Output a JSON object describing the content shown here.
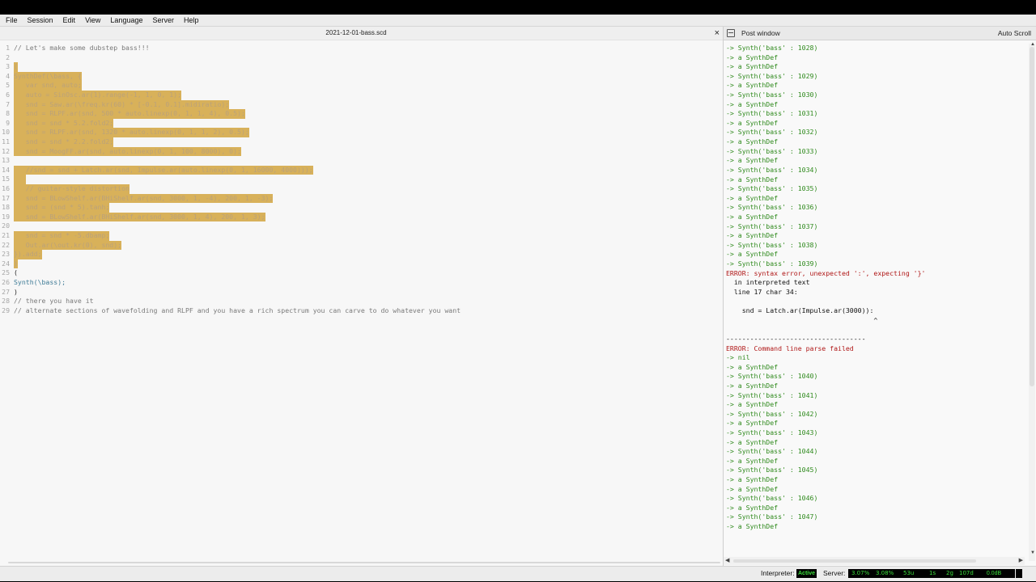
{
  "menu": [
    "File",
    "Session",
    "Edit",
    "View",
    "Language",
    "Server",
    "Help"
  ],
  "editor": {
    "title": "2021-12-01-bass.scd",
    "close": "×",
    "lines": [
      {
        "n": "1",
        "text": "// Let's make some dubstep bass!!!",
        "cls": "comment",
        "sel": false
      },
      {
        "n": "2",
        "text": "",
        "cls": "plain",
        "sel": false
      },
      {
        "n": "3",
        "text": "(",
        "cls": "plain",
        "sel": true
      },
      {
        "n": "4",
        "text": "SynthDef(\\bass, {",
        "cls": "plain",
        "sel": true
      },
      {
        "n": "5",
        "text": "   var snd, auto;",
        "cls": "plain",
        "sel": true
      },
      {
        "n": "6",
        "text": "   auto = SinOsc.ar(1).range(-1, 1, 0, 1);",
        "cls": "plain",
        "sel": true
      },
      {
        "n": "7",
        "text": "   snd = Saw.ar(\\freq.kr(60) * [-0.1, 0.1].midiratio);",
        "cls": "plain",
        "sel": true
      },
      {
        "n": "8",
        "text": "   snd = RLPF.ar(snd, 500 * auto.linexp(0, 1, 1, 4), 0.5);",
        "cls": "plain",
        "sel": true
      },
      {
        "n": "9",
        "text": "   snd = snd * 5.2.fold2;",
        "cls": "plain",
        "sel": true
      },
      {
        "n": "10",
        "text": "   snd = RLPF.ar(snd, 1320 * auto.linexp(0, 1, 1, 2), 0.5);",
        "cls": "plain",
        "sel": true
      },
      {
        "n": "11",
        "text": "   snd = snd * 2.2.fold2;",
        "cls": "plain",
        "sel": true
      },
      {
        "n": "12",
        "text": "   snd = MoogFF.ar(snd, auto.linexp(0, 1, 100, 8000), 0);",
        "cls": "plain",
        "sel": true
      },
      {
        "n": "13",
        "text": "",
        "cls": "plain",
        "sel": true
      },
      {
        "n": "14",
        "text": "   //snd = snd + Latch.ar(snd, Impulse.ar(auto.linexp(0, 1, 16000, 4000)));",
        "cls": "plain",
        "sel": true
      },
      {
        "n": "15",
        "text": "   ",
        "cls": "plain",
        "sel": true
      },
      {
        "n": "16",
        "text": "   // guitar-style distortion",
        "cls": "plain",
        "sel": true
      },
      {
        "n": "17",
        "text": "   snd = BLowShelf.ar(BHiShelf.ar(snd, 3000, 1, -4), 200, 1, -3);",
        "cls": "plain",
        "sel": true
      },
      {
        "n": "18",
        "text": "   snd = (snd * 5).tanh;",
        "cls": "plain",
        "sel": true
      },
      {
        "n": "19",
        "text": "   snd = BLowShelf.ar(BHiShelf.ar(snd, 3000, 1, 4), 200, 1, 3);",
        "cls": "plain",
        "sel": true
      },
      {
        "n": "20",
        "text": "",
        "cls": "plain",
        "sel": false
      },
      {
        "n": "21",
        "text": "   snd = snd * -5.dbamp;",
        "cls": "plain",
        "sel": true
      },
      {
        "n": "22",
        "text": "   Out.ar(\\out.kr(0), snd);",
        "cls": "plain",
        "sel": true
      },
      {
        "n": "23",
        "text": "}).add;",
        "cls": "plain",
        "sel": true
      },
      {
        "n": "24",
        "text": ")",
        "cls": "plain",
        "sel": true
      },
      {
        "n": "25",
        "text": "(",
        "cls": "plain",
        "sel": false
      },
      {
        "n": "26",
        "text": "Synth(\\bass);",
        "cls": "def",
        "sel": false
      },
      {
        "n": "27",
        "text": ")",
        "cls": "plain",
        "sel": false
      },
      {
        "n": "28",
        "text": "// there you have it",
        "cls": "comment",
        "sel": false
      },
      {
        "n": "29",
        "text": "// alternate sections of wavefolding and RLPF and you have a rich spectrum you can carve to do whatever you want",
        "cls": "comment",
        "sel": false
      }
    ]
  },
  "post": {
    "title": "Post window",
    "autoscroll": "Auto Scroll",
    "lines": [
      {
        "t": "-> Synth('bass' : 1028)",
        "c": "green"
      },
      {
        "t": "-> a SynthDef",
        "c": "green"
      },
      {
        "t": "-> a SynthDef",
        "c": "green"
      },
      {
        "t": "-> Synth('bass' : 1029)",
        "c": "green"
      },
      {
        "t": "-> a SynthDef",
        "c": "green"
      },
      {
        "t": "-> Synth('bass' : 1030)",
        "c": "green"
      },
      {
        "t": "-> a SynthDef",
        "c": "green"
      },
      {
        "t": "-> Synth('bass' : 1031)",
        "c": "green"
      },
      {
        "t": "-> a SynthDef",
        "c": "green"
      },
      {
        "t": "-> Synth('bass' : 1032)",
        "c": "green"
      },
      {
        "t": "-> a SynthDef",
        "c": "green"
      },
      {
        "t": "-> Synth('bass' : 1033)",
        "c": "green"
      },
      {
        "t": "-> a SynthDef",
        "c": "green"
      },
      {
        "t": "-> Synth('bass' : 1034)",
        "c": "green"
      },
      {
        "t": "-> a SynthDef",
        "c": "green"
      },
      {
        "t": "-> Synth('bass' : 1035)",
        "c": "green"
      },
      {
        "t": "-> a SynthDef",
        "c": "green"
      },
      {
        "t": "-> Synth('bass' : 1036)",
        "c": "green"
      },
      {
        "t": "-> a SynthDef",
        "c": "green"
      },
      {
        "t": "-> Synth('bass' : 1037)",
        "c": "green"
      },
      {
        "t": "-> a SynthDef",
        "c": "green"
      },
      {
        "t": "-> Synth('bass' : 1038)",
        "c": "green"
      },
      {
        "t": "-> a SynthDef",
        "c": "green"
      },
      {
        "t": "-> Synth('bass' : 1039)",
        "c": "green"
      },
      {
        "t": "ERROR: syntax error, unexpected ':', expecting '}'",
        "c": "red"
      },
      {
        "t": "  in interpreted text",
        "c": "black"
      },
      {
        "t": "  line 17 char 34:",
        "c": "black"
      },
      {
        "t": "",
        "c": "black"
      },
      {
        "t": "    snd = Latch.ar(Impulse.ar(3000)):",
        "c": "black"
      },
      {
        "t": "                                     ^",
        "c": "black"
      },
      {
        "t": "",
        "c": "black"
      },
      {
        "t": "-----------------------------------",
        "c": "black"
      },
      {
        "t": "ERROR: Command line parse failed",
        "c": "red"
      },
      {
        "t": "-> nil",
        "c": "green"
      },
      {
        "t": "-> a SynthDef",
        "c": "green"
      },
      {
        "t": "-> Synth('bass' : 1040)",
        "c": "green"
      },
      {
        "t": "-> a SynthDef",
        "c": "green"
      },
      {
        "t": "-> Synth('bass' : 1041)",
        "c": "green"
      },
      {
        "t": "-> a SynthDef",
        "c": "green"
      },
      {
        "t": "-> Synth('bass' : 1042)",
        "c": "green"
      },
      {
        "t": "-> a SynthDef",
        "c": "green"
      },
      {
        "t": "-> Synth('bass' : 1043)",
        "c": "green"
      },
      {
        "t": "-> a SynthDef",
        "c": "green"
      },
      {
        "t": "-> Synth('bass' : 1044)",
        "c": "green"
      },
      {
        "t": "-> a SynthDef",
        "c": "green"
      },
      {
        "t": "-> Synth('bass' : 1045)",
        "c": "green"
      },
      {
        "t": "-> a SynthDef",
        "c": "green"
      },
      {
        "t": "-> a SynthDef",
        "c": "green"
      },
      {
        "t": "-> Synth('bass' : 1046)",
        "c": "green"
      },
      {
        "t": "-> a SynthDef",
        "c": "green"
      },
      {
        "t": "-> Synth('bass' : 1047)",
        "c": "green"
      },
      {
        "t": "-> a SynthDef",
        "c": "green"
      }
    ]
  },
  "status": {
    "interpreter_label": "Interpreter:",
    "interpreter_state": "Active",
    "server_label": "Server:",
    "avg_cpu": "3.07%",
    "peak_cpu": "3.08%",
    "ugens": "53u",
    "synths": "1s",
    "groups": "2g",
    "synthdefs": "107d",
    "volume": "0.0dB"
  },
  "colors": {
    "selection": "#d8b15a",
    "post_green": "#2f8a1d",
    "post_red": "#b01818",
    "status_green": "#3bdd3b"
  }
}
